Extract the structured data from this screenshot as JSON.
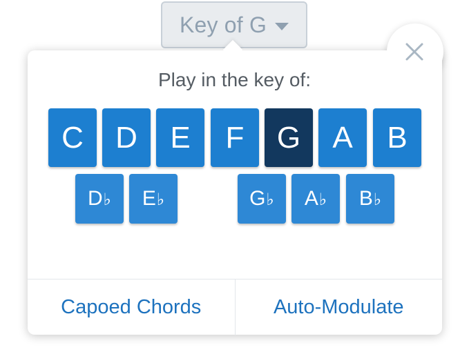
{
  "selector": {
    "label": "Key of G"
  },
  "popover": {
    "prompt": "Play in the key of:",
    "natural_keys": [
      {
        "label": "C",
        "selected": false
      },
      {
        "label": "D",
        "selected": false
      },
      {
        "label": "E",
        "selected": false
      },
      {
        "label": "F",
        "selected": false
      },
      {
        "label": "G",
        "selected": true
      },
      {
        "label": "A",
        "selected": false
      },
      {
        "label": "B",
        "selected": false
      }
    ],
    "flat_keys": [
      {
        "label": "D",
        "accidental": "♭"
      },
      {
        "label": "E",
        "accidental": "♭"
      },
      {
        "label": "G",
        "accidental": "♭"
      },
      {
        "label": "A",
        "accidental": "♭"
      },
      {
        "label": "B",
        "accidental": "♭"
      }
    ],
    "footer": {
      "capoed_label": "Capoed Chords",
      "modulate_label": "Auto-Modulate"
    }
  },
  "icons": {
    "close": "close-icon",
    "caret": "chevron-down-icon"
  },
  "colors": {
    "key_button": "#1d7fd0",
    "key_selected": "#12385e",
    "link": "#1d72be",
    "selector_text": "#8fa0b0"
  }
}
